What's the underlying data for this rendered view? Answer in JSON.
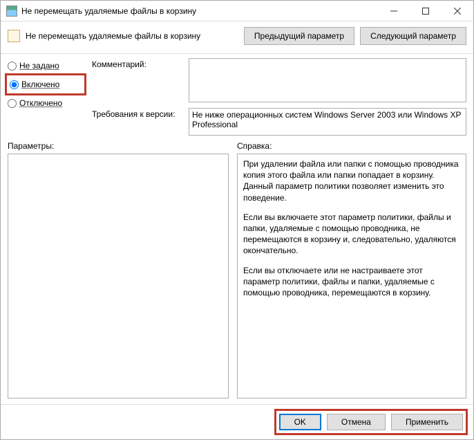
{
  "window": {
    "title": "Не перемещать удаляемые файлы в корзину"
  },
  "header": {
    "title": "Не перемещать удаляемые файлы в корзину",
    "prev": "Предыдущий параметр",
    "next": "Следующий параметр"
  },
  "radios": {
    "not_configured": "Не задано",
    "enabled": "Включено",
    "disabled": "Отключено",
    "selected": "enabled"
  },
  "labels": {
    "comment": "Комментарий:",
    "requirements": "Требования к версии:",
    "options": "Параметры:",
    "help": "Справка:"
  },
  "comment": "",
  "requirements": "Не ниже операционных систем Windows Server 2003 или Windows XP Professional",
  "help": {
    "p1": "При удалении файла или папки с помощью проводника копия этого файла или папки попадает в корзину. Данный параметр политики позволяет изменить это поведение.",
    "p2": "Если вы включаете этот параметр политики, файлы и папки, удаляемые с помощью проводника, не перемещаются в корзину и, следовательно, удаляются окончательно.",
    "p3": "Если вы отключаете или не настраиваете этот параметр политики, файлы и папки, удаляемые с помощью проводника, перемещаются в корзину."
  },
  "footer": {
    "ok": "OK",
    "cancel": "Отмена",
    "apply": "Применить"
  }
}
